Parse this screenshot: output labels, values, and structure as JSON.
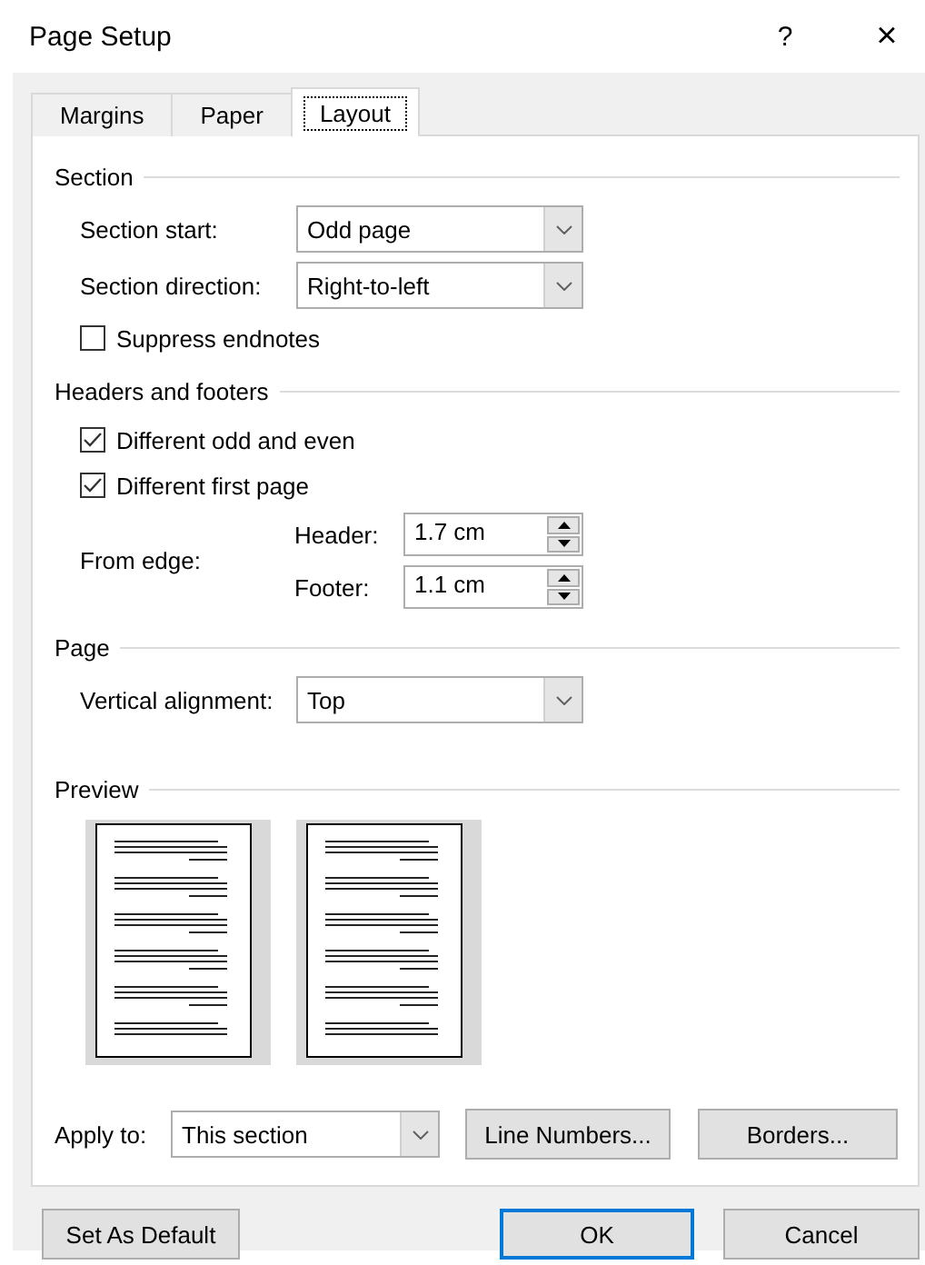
{
  "window": {
    "title": "Page Setup",
    "help": "?",
    "close": "×"
  },
  "tabs": [
    {
      "label": "Margins",
      "selected": false
    },
    {
      "label": "Paper",
      "selected": false
    },
    {
      "label": "Layout",
      "selected": true
    }
  ],
  "section": {
    "title": "Section",
    "fields": [
      {
        "label": "Section start:",
        "value": "Odd page"
      },
      {
        "label": "Section direction:",
        "value": "Right-to-left"
      }
    ],
    "checkboxes": [
      {
        "label": "Suppress endnotes",
        "checked": false
      }
    ]
  },
  "headers_and_footers": {
    "title": "Headers and footers",
    "checkboxes": [
      {
        "label": "Different odd and even",
        "checked": true
      },
      {
        "label": "Different first page",
        "checked": true
      }
    ],
    "from_edge": {
      "label": "From edge:",
      "fields": [
        {
          "label": "Header:",
          "value": "1.7 cm"
        },
        {
          "label": "Footer:",
          "value": "1.1 cm"
        }
      ]
    }
  },
  "page": {
    "title": "Page",
    "fields": [
      {
        "label": "Vertical alignment:",
        "value": "Top"
      }
    ]
  },
  "preview": {
    "title": "Preview"
  },
  "apply_to": {
    "label": "Apply to:",
    "value": "This section"
  },
  "buttons": [
    {
      "label": "Line Numbers...",
      "default": false
    },
    {
      "label": "Borders...",
      "default": false
    }
  ],
  "footer_buttons": [
    {
      "label": "Set As Default",
      "default": false
    },
    {
      "label": "OK",
      "default": true
    },
    {
      "label": "Cancel",
      "default": false
    }
  ]
}
